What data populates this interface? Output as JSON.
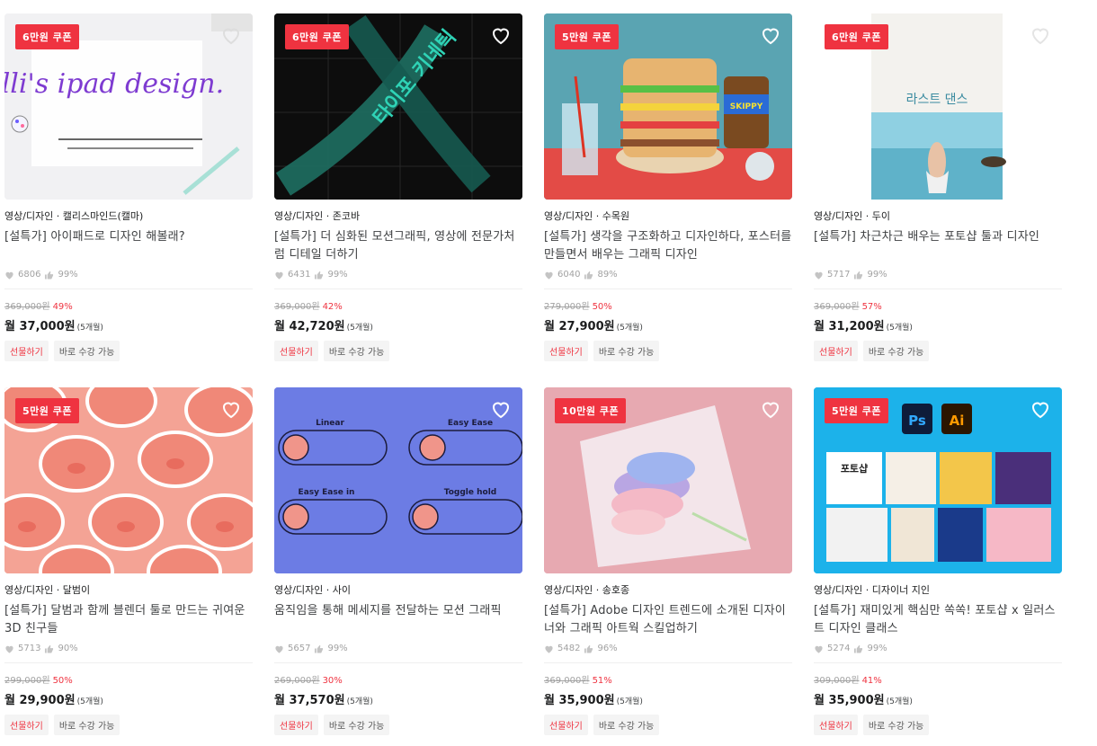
{
  "cards": [
    {
      "coupon": "6만원 쿠폰",
      "meta": "영상/디자인 · 캘리스마인드(캘마)",
      "title": "[설특가] 아이패드로 디자인 해볼래?",
      "likes": "6806",
      "rate": "99%",
      "orig": "369,000원",
      "disc": "49%",
      "monthly": "월 37,000원",
      "months": "(5개월)",
      "gift": "선물하기",
      "instant": "바로 수강 가능",
      "thumb_text": "Calli's ipad design."
    },
    {
      "coupon": "6만원 쿠폰",
      "meta": "영상/디자인 · 존코바",
      "title": "[설특가] 더 심화된 모션그래픽, 영상에 전문가처럼 디테일 더하기",
      "likes": "6431",
      "rate": "99%",
      "orig": "369,000원",
      "disc": "42%",
      "monthly": "월 42,720원",
      "months": "(5개월)",
      "gift": "선물하기",
      "instant": "바로 수강 가능",
      "thumb_text": "타이포 키네틱"
    },
    {
      "coupon": "5만원 쿠폰",
      "meta": "영상/디자인 · 수목원",
      "title": "[설특가] 생각을 구조화하고 디자인하다, 포스터를 만들면서 배우는 그래픽 디자인",
      "likes": "6040",
      "rate": "89%",
      "orig": "279,000원",
      "disc": "50%",
      "monthly": "월 27,900원",
      "months": "(5개월)",
      "gift": "선물하기",
      "instant": "바로 수강 가능",
      "thumb_text": "SKIPPY"
    },
    {
      "coupon": "6만원 쿠폰",
      "meta": "영상/디자인 · 두이",
      "title": "[설특가] 차근차근 배우는 포토샵 툴과 디자인",
      "likes": "5717",
      "rate": "99%",
      "orig": "369,000원",
      "disc": "57%",
      "monthly": "월 31,200원",
      "months": "(5개월)",
      "gift": "선물하기",
      "instant": "바로 수강 가능",
      "thumb_text": "라스트 댄스"
    },
    {
      "coupon": "5만원 쿠폰",
      "meta": "영상/디자인 · 달범이",
      "title": "[설특가] 달범과 함께 블렌더 툴로 만드는 귀여운 3D 친구들",
      "likes": "5713",
      "rate": "90%",
      "orig": "299,000원",
      "disc": "50%",
      "monthly": "월 29,900원",
      "months": "(5개월)",
      "gift": "선물하기",
      "instant": "바로 수강 가능",
      "thumb_text": ""
    },
    {
      "coupon": "",
      "meta": "영상/디자인 · 사이",
      "title": "움직임을 통해 메세지를 전달하는 모션 그래픽",
      "likes": "5657",
      "rate": "99%",
      "orig": "269,000원",
      "disc": "30%",
      "monthly": "월 37,570원",
      "months": "(5개월)",
      "gift": "선물하기",
      "instant": "바로 수강 가능",
      "labels": [
        "Linear",
        "Easy Ease",
        "Easy Ease in",
        "Toggle hold"
      ]
    },
    {
      "coupon": "10만원 쿠폰",
      "meta": "영상/디자인 · 송호종",
      "title": "[설특가] Adobe 디자인 트렌드에 소개된 디자이너와 그래픽 아트웍 스킬업하기",
      "likes": "5482",
      "rate": "96%",
      "orig": "369,000원",
      "disc": "51%",
      "monthly": "월 35,900원",
      "months": "(5개월)",
      "gift": "선물하기",
      "instant": "바로 수강 가능",
      "thumb_text": ""
    },
    {
      "coupon": "5만원 쿠폰",
      "meta": "영상/디자인 · 디자이너 지인",
      "title": "[설특가] 재미있게 핵심만 쏙쏙! 포토샵 x 일러스트 디자인 클래스",
      "likes": "5274",
      "rate": "99%",
      "orig": "309,000원",
      "disc": "41%",
      "monthly": "월 35,900원",
      "months": "(5개월)",
      "gift": "선물하기",
      "instant": "바로 수강 가능",
      "thumb_text": "포토샵",
      "ps": "Ps",
      "ai": "Ai"
    }
  ],
  "colors": {
    "accent": "#ef3340"
  }
}
